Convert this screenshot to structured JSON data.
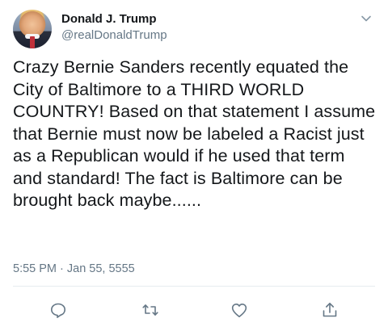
{
  "author": {
    "display_name": "Donald J. Trump",
    "handle": "@realDonaldTrump"
  },
  "tweet": {
    "text": "Crazy Bernie Sanders recently equated the City of Baltimore to a THIRD WORLD COUNTRY! Based on that statement I assume that Bernie must now be labeled a Racist just as a Republican would if he used that term and standard! The fact is Baltimore can be brought back maybe......",
    "timestamp": "5:55 PM · Jan 55, 5555"
  },
  "icons": {
    "menu": "chevron-down-icon",
    "reply": "reply-icon",
    "retweet": "retweet-icon",
    "like": "heart-icon",
    "share": "share-icon"
  },
  "colors": {
    "text": "#14171a",
    "secondary": "#657786",
    "divider": "#e6ecf0"
  }
}
